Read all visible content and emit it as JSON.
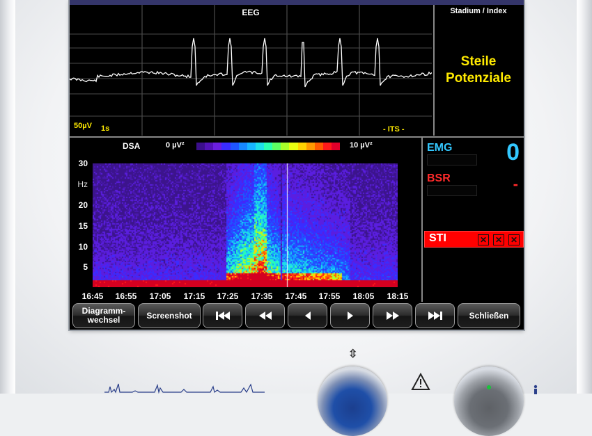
{
  "eeg": {
    "title": "EEG",
    "scale_amplitude": "50µV",
    "scale_time": "1s",
    "channel_label": "- ITS -"
  },
  "stadium": {
    "title": "Stadium / Index",
    "value_line1": "Steile",
    "value_line2": "Potenziale"
  },
  "dsa": {
    "title": "DSA",
    "scale_min": "0 µV²",
    "scale_max": "10 µV²",
    "y_unit": "Hz",
    "y_ticks": [
      "30",
      "20",
      "15",
      "10",
      "5"
    ],
    "x_ticks": [
      "16:45",
      "16:55",
      "17:05",
      "17:15",
      "17:25",
      "17:35",
      "17:45",
      "17:55",
      "18:05",
      "18:15"
    ]
  },
  "indicators": {
    "emg_label": "EMG",
    "emg_value": "0",
    "bsr_label": "BSR",
    "bsr_value": "-",
    "sti_label": "STI",
    "sti_marks": [
      "✕",
      "✕",
      "✕"
    ]
  },
  "buttons": {
    "diagram_line1": "Diagramm-",
    "diagram_line2": "wechsel",
    "screenshot": "Screenshot",
    "close": "Schließen"
  },
  "device": {
    "arrow_glyph": "⇳"
  },
  "colors": {
    "eeg_trace": "#ffffff",
    "text_yellow": "#ffea00",
    "emg_cyan": "#33c8ff",
    "bsr_red": "#ff2a2a",
    "sti_red": "#ff0000",
    "spectro_background": "#3c148c"
  },
  "icons": {
    "first": "skip-first-icon",
    "rewind": "fast-rewind-icon",
    "back": "step-back-icon",
    "forward": "step-forward-icon",
    "fast_forward": "fast-forward-icon",
    "last": "skip-last-icon",
    "warning": "warning-triangle-icon",
    "person": "person-icon"
  }
}
